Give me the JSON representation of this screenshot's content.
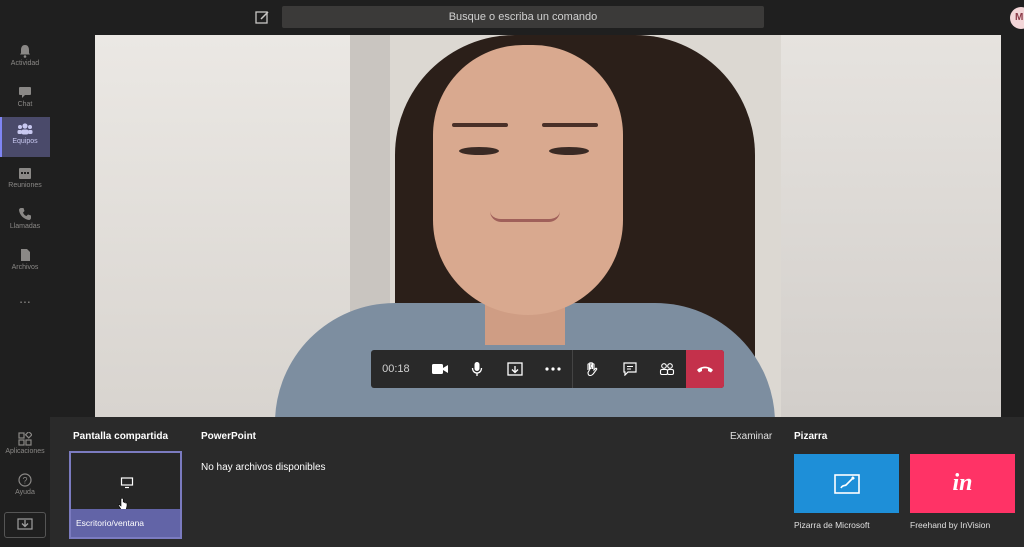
{
  "header": {
    "search_placeholder": "Busque o escriba un comando",
    "avatar_initial": "M"
  },
  "rail": {
    "items": [
      {
        "label": "Actividad",
        "icon": "bell-icon"
      },
      {
        "label": "Chat",
        "icon": "chat-icon"
      },
      {
        "label": "Equipos",
        "icon": "teams-icon",
        "active": true
      },
      {
        "label": "Reuniones",
        "icon": "calendar-icon"
      },
      {
        "label": "Llamadas",
        "icon": "phone-icon"
      },
      {
        "label": "Archivos",
        "icon": "file-icon"
      }
    ],
    "more": "...",
    "bottom": [
      {
        "label": "Aplicaciones",
        "icon": "apps-icon"
      },
      {
        "label": "Ayuda",
        "icon": "help-icon"
      }
    ]
  },
  "call": {
    "timer": "00:18",
    "accent": "#6264a7",
    "hangup_color": "#c4314b"
  },
  "share": {
    "screen_title": "Pantalla compartida",
    "screen_tile_label": "Escritorio/ventana",
    "ppt_title": "PowerPoint",
    "ppt_empty": "No hay archivos disponibles",
    "browse_label": "Examinar",
    "whiteboard_title": "Pizarra",
    "whiteboards": [
      {
        "label": "Pizarra de Microsoft",
        "color": "#1e8fd8"
      },
      {
        "label": "Freehand by InVision",
        "color": "#ff3366",
        "glyph": "in"
      }
    ]
  }
}
